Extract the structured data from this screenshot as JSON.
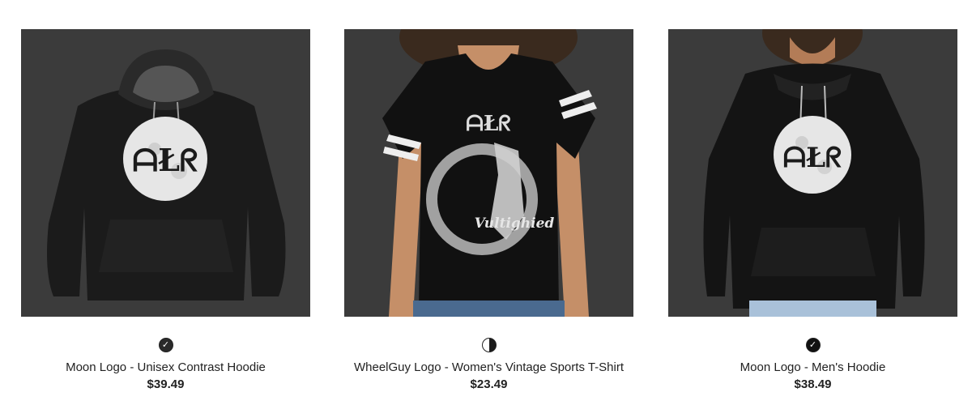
{
  "products": [
    {
      "title": "Moon Logo - Unisex Contrast Hoodie",
      "price": "$39.49",
      "image_alt": "Unisex Contrast Hoodie",
      "image_bg": "#3b3b3b",
      "swatch": "dark-heather",
      "swatch_selected": true,
      "print_text": "ᗩŁᖇ"
    },
    {
      "title": "WheelGuy Logo - Women's Vintage Sports T-Shirt",
      "price": "$23.49",
      "image_alt": "Women's Vintage Sports T-Shirt",
      "image_bg": "#3b3b3b",
      "swatch": "black-white",
      "swatch_selected": false,
      "print_text": "Vultighied"
    },
    {
      "title": "Moon Logo - Men's Hoodie",
      "price": "$38.49",
      "image_alt": "Men's Hoodie",
      "image_bg": "#3b3b3b",
      "swatch": "black",
      "swatch_selected": true,
      "print_text": "ᗩŁᖇ"
    }
  ]
}
